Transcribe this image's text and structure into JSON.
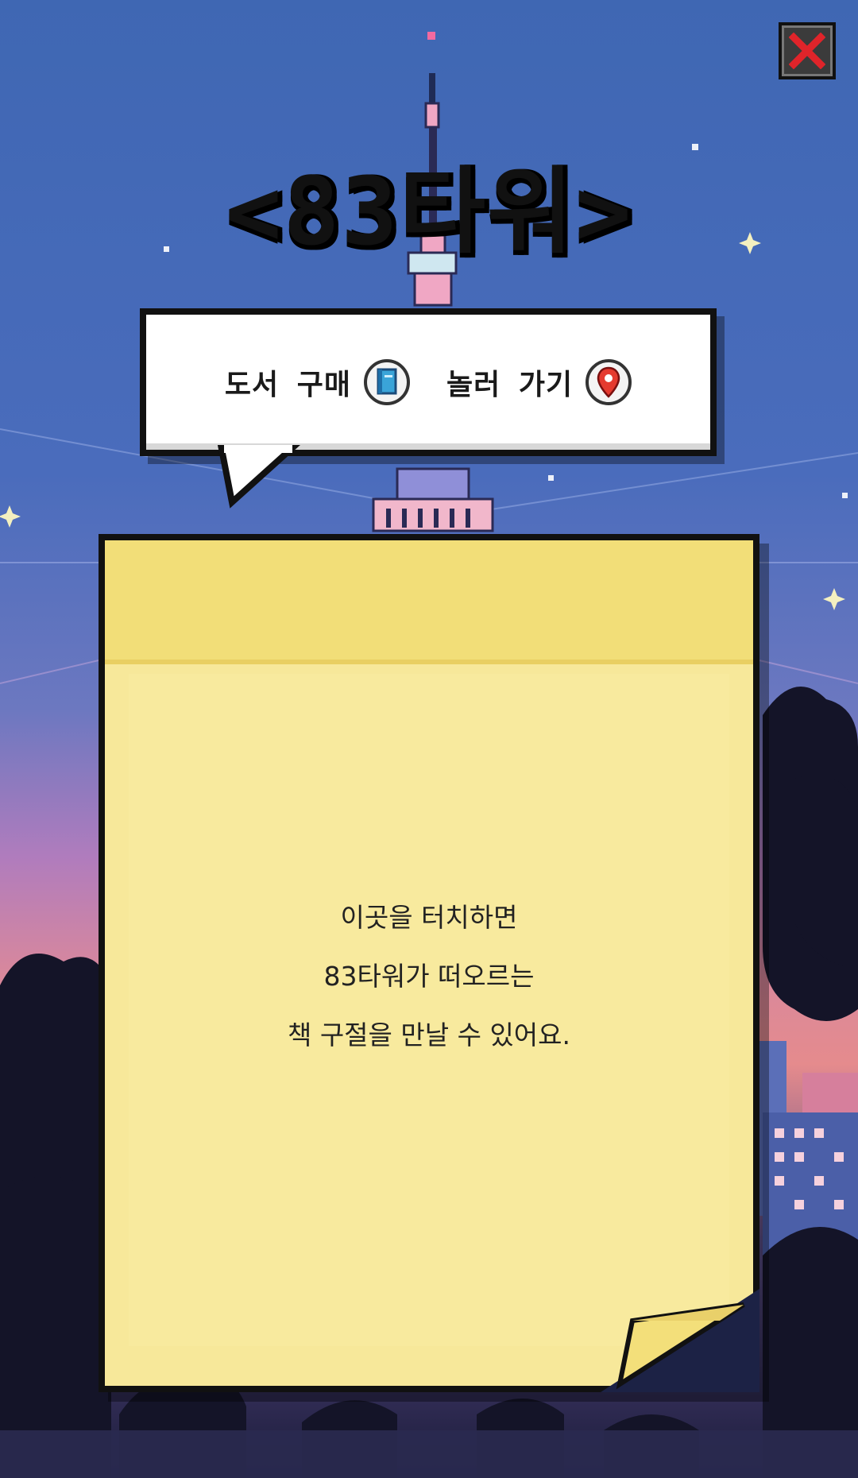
{
  "window": {
    "close_icon": "close-icon"
  },
  "title": "<83타워>",
  "bubble": {
    "items": [
      {
        "label": "도서 구매",
        "icon": "book-icon"
      },
      {
        "label": "놀러 가기",
        "icon": "location-pin-icon"
      }
    ]
  },
  "note": {
    "lines": [
      "이곳을 터치하면",
      "83타워가 떠오르는",
      "책 구절을 만날 수 있어요."
    ]
  },
  "colors": {
    "sky_top": "#3f67b3",
    "sunset": "#e58b8d",
    "note": "#f7e89a",
    "close_red": "#e0242a"
  }
}
